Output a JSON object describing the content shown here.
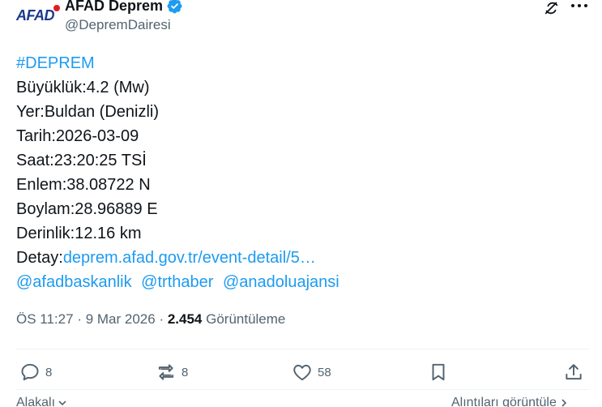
{
  "tweet": {
    "author": {
      "avatar_text": "AFAD",
      "display_name": "AFAD Deprem",
      "handle": "@DepremDairesi"
    },
    "icons": {
      "verified": "verified-badge-icon",
      "grok": "grok-icon",
      "more": "more-icon"
    },
    "hashtag": "#DEPREM",
    "lines": [
      "Büyüklük:4.2 (Mw)",
      "Yer:Buldan (Denizli)",
      "Tarih:2026-03-09",
      "Saat:23:20:25 TSİ",
      "Enlem:38.08722 N",
      "Boylam:28.96889 E",
      "Derinlik:12.16 km"
    ],
    "detail_label": "Detay:",
    "detail_link": "deprem.afad.gov.tr/event-detail/5…",
    "mentions": [
      "@afadbaskanlik",
      "@trthaber",
      "@anadoluajansi"
    ],
    "meta": {
      "time": "ÖS 11:27",
      "date": "9 Mar 2026",
      "views_count": "2.454",
      "views_label": "Görüntüleme"
    },
    "actions": {
      "replies": "8",
      "reposts": "8",
      "likes": "58"
    },
    "footer": {
      "left_label": "Alakalı",
      "right_label": "Alıntıları görüntüle"
    },
    "colors": {
      "link": "#1d9bf0",
      "secondary_text": "#536471",
      "primary_text": "#0f1419",
      "verified": "#1d9bf0"
    }
  }
}
